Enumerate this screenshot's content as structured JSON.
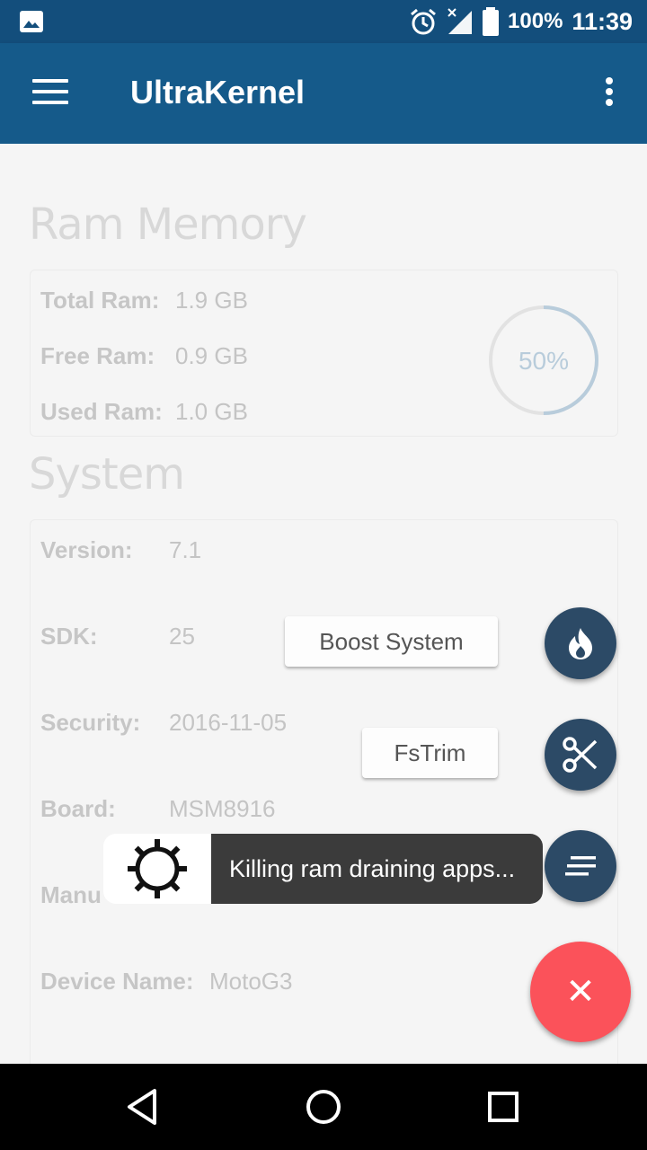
{
  "status_bar": {
    "battery": "100%",
    "time": "11:39",
    "icons": [
      "image-icon",
      "alarm-icon",
      "signal-icon",
      "battery-icon"
    ]
  },
  "app_bar": {
    "title": "UltraKernel",
    "icons": [
      "menu-icon",
      "more-vert-icon"
    ]
  },
  "ram": {
    "heading": "Ram Memory",
    "rows": [
      {
        "label": "Total Ram:",
        "value": "1.9 GB"
      },
      {
        "label": "Free Ram:",
        "value": "0.9 GB"
      },
      {
        "label": "Used Ram:",
        "value": "1.0 GB"
      }
    ],
    "usage_percent_label": "50%",
    "usage_fraction": 0.5,
    "accent": "#b8ccdb"
  },
  "system": {
    "heading": "System",
    "rows": [
      {
        "label": "Version:",
        "value": "7.1"
      },
      {
        "label": "SDK:",
        "value": "25"
      },
      {
        "label": "Security:",
        "value": "2016-11-05"
      },
      {
        "label": "Board:",
        "value": "MSM8916"
      },
      {
        "label": "Manu",
        "value": ""
      },
      {
        "label": "Device Name:",
        "value": "MotoG3"
      }
    ]
  },
  "actions": {
    "boost_label": "Boost System",
    "fstrim_label": "FsTrim",
    "fab_icons": [
      "fire-icon",
      "scissors-icon",
      "notes-icon",
      "close-icon"
    ],
    "close_glyph": "✕",
    "fab_color": "#2c4a66",
    "main_fab_color": "#fb525a"
  },
  "toast": {
    "message": "Killing ram draining apps...",
    "icon": "gear-icon"
  },
  "nav_bar": {
    "icons": [
      "back-icon",
      "home-icon",
      "recents-icon"
    ]
  }
}
